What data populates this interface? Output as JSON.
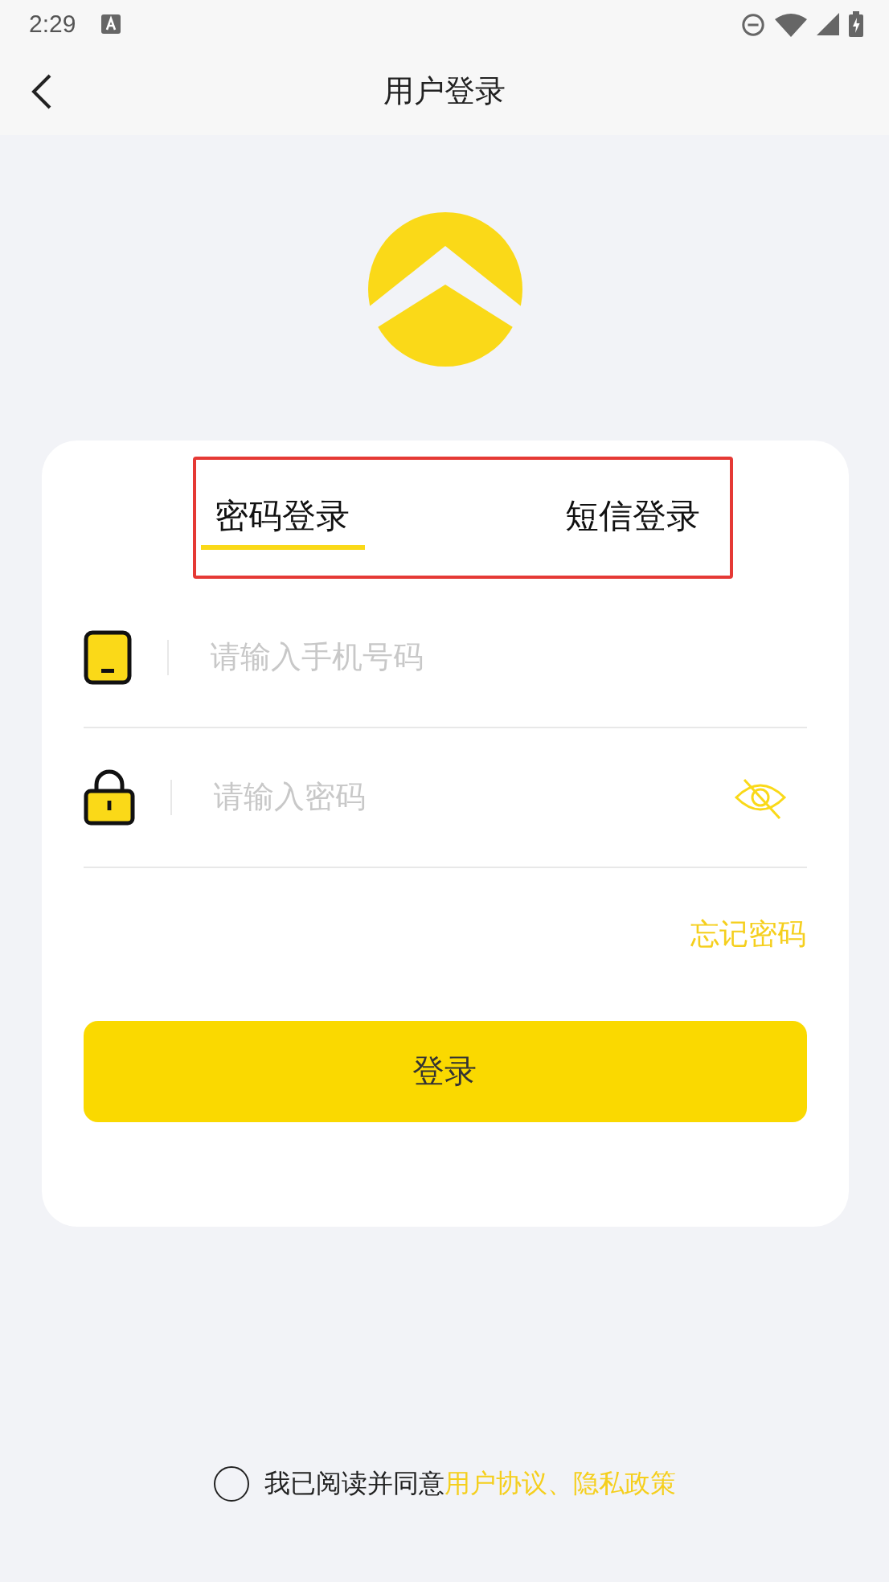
{
  "status_bar": {
    "time": "2:29"
  },
  "nav": {
    "title": "用户登录"
  },
  "tabs": [
    {
      "label": "密码登录",
      "selected": true
    },
    {
      "label": "短信登录",
      "selected": false
    }
  ],
  "fields": [
    {
      "kind": "phone",
      "placeholder": "请输入手机号码"
    },
    {
      "kind": "password",
      "placeholder": "请输入密码",
      "password_visible": false
    }
  ],
  "forgot_link": "忘记密码",
  "login_button": "登录",
  "agreement": {
    "checked": false,
    "text": "我已阅读并同意",
    "links": "用户协议、隐私政策"
  }
}
